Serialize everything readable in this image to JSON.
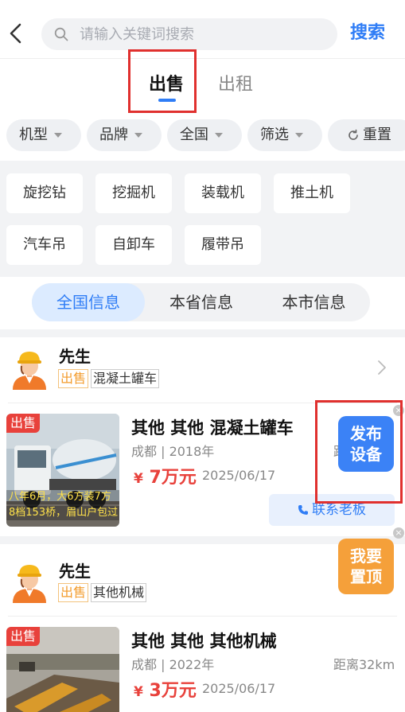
{
  "search": {
    "placeholder": "请输入关键词搜索",
    "button_label": "搜索"
  },
  "type_tabs": [
    {
      "label": "出售",
      "active": true
    },
    {
      "label": "出租",
      "active": false
    }
  ],
  "filters": [
    "机型",
    "品牌",
    "全国",
    "筛选"
  ],
  "reset_label": "重置",
  "categories": [
    "旋挖钻",
    "挖掘机",
    "装载机",
    "推土机",
    "汽车吊",
    "自卸车",
    "履带吊"
  ],
  "region_tabs": [
    {
      "label": "全国信息",
      "active": true
    },
    {
      "label": "本省信息",
      "active": false
    },
    {
      "label": "本市信息",
      "active": false
    }
  ],
  "listings": [
    {
      "seller": "先生",
      "tag_sale": "出售",
      "tag_category": "混凝土罐车",
      "thumb_badge": "出售",
      "thumb_caption_1": "八年6月，大6方装7方",
      "thumb_caption_2": "8档153桥，眉山户包过",
      "title": "其他 其他 混凝土罐车",
      "meta": "成都 | 2018年",
      "price": "7万元",
      "date": "2025/06/17",
      "distance": "距",
      "contact_label": "联系老板"
    },
    {
      "seller": "先生",
      "tag_sale": "出售",
      "tag_category": "其他机械",
      "thumb_badge": "出售",
      "title": "其他 其他 其他机械",
      "meta": "成都 | 2022年",
      "price": "3万元",
      "date": "2025/06/17",
      "distance": "距离32km"
    }
  ],
  "currency_symbol": "¥",
  "float_buttons": {
    "publish": {
      "line1": "发布",
      "line2": "设备"
    },
    "top": {
      "line1": "我要",
      "line2": "置顶"
    }
  },
  "colors": {
    "accent": "#2f7df6",
    "price": "#e8413b",
    "sale_tag": "#f39c2d",
    "top_button": "#f5a03a",
    "highlight": "#e0302e"
  }
}
